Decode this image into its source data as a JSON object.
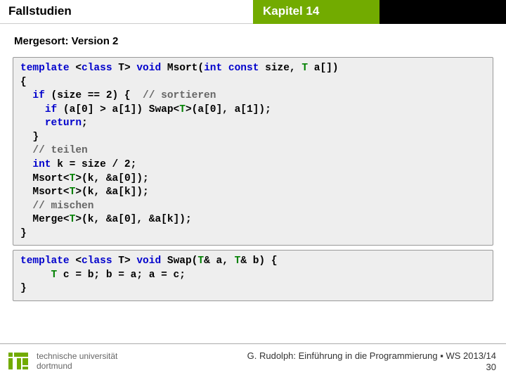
{
  "header": {
    "left": "Fallstudien",
    "chapter": "Kapitel 14"
  },
  "subtitle": "Mergesort: Version 2",
  "code1": {
    "l1a": "template",
    "l1b": " <",
    "l1c": "class",
    "l1d": " T> ",
    "l1e": "void",
    "l1f": " Msort(",
    "l1g": "int",
    "l1h": " ",
    "l1i": "const",
    "l1j": " size, ",
    "l1k": "T",
    "l1l": " a[])",
    "l2": "{",
    "l3a": "  ",
    "l3b": "if",
    "l3c": " (size == 2) {  ",
    "l3d": "// sortieren",
    "l4a": "    ",
    "l4b": "if",
    "l4c": " (a[0] > a[1]) Swap<",
    "l4d": "T",
    "l4e": ">(a[0], a[1]);",
    "l5a": "    ",
    "l5b": "return",
    "l5c": ";",
    "l6": "  }",
    "l7a": "  ",
    "l7b": "// teilen",
    "l8a": "  ",
    "l8b": "int",
    "l8c": " k = size / 2;",
    "l9a": "  Msort<",
    "l9b": "T",
    "l9c": ">(k, &a[0]);",
    "l10a": "  Msort<",
    "l10b": "T",
    "l10c": ">(k, &a[k]);",
    "l11a": "  ",
    "l11b": "// mischen",
    "l12a": "  Merge<",
    "l12b": "T",
    "l12c": ">(k, &a[0], &a[k]);",
    "l13": "}"
  },
  "code2": {
    "l1a": "template",
    "l1b": " <",
    "l1c": "class",
    "l1d": " T> ",
    "l1e": "void",
    "l1f": " Swap(",
    "l1g": "T",
    "l1h": "& a, ",
    "l1i": "T",
    "l1j": "& b) {",
    "l2a": "     ",
    "l2b": "T",
    "l2c": " c = b; b = a; a = c;",
    "l3": "}"
  },
  "footer": {
    "uni1": "technische universität",
    "uni2": "dortmund",
    "credit": "G. Rudolph: Einführung in die Programmierung ▪ WS 2013/14",
    "page": "30"
  }
}
